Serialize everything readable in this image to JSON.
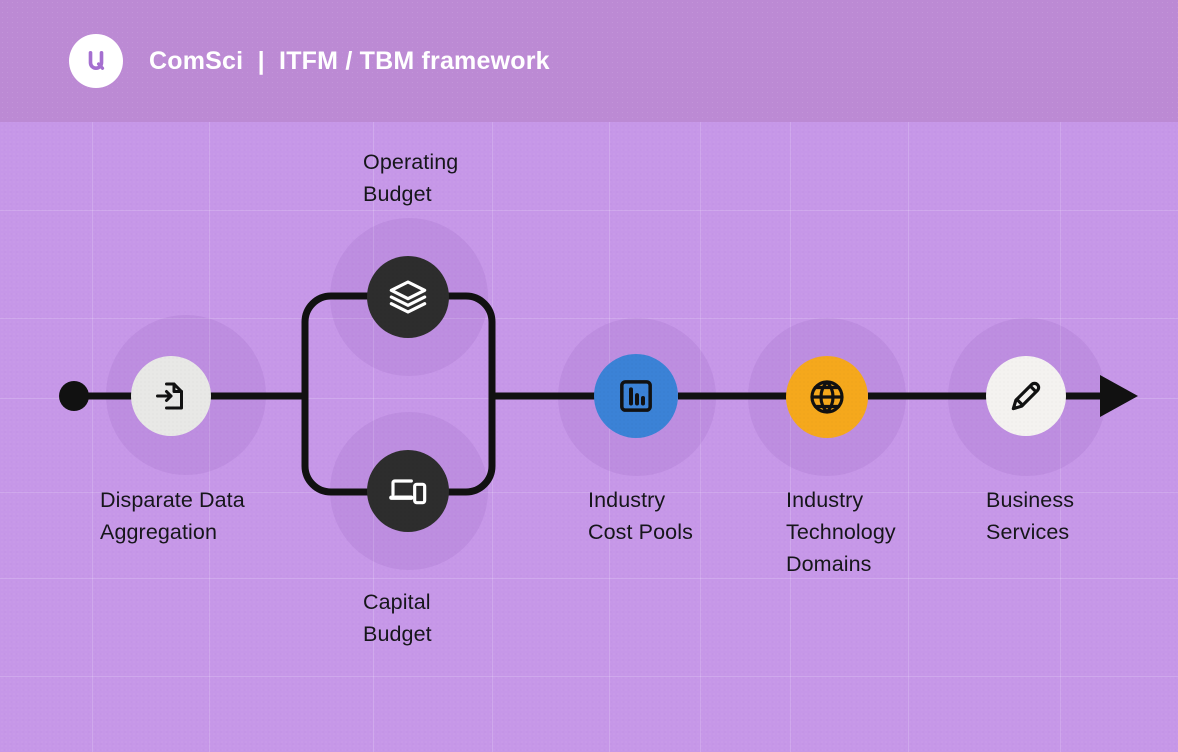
{
  "header": {
    "logo_icon": "comsci-u-logo",
    "title": "ComSci  |  ITFM / TBM framework"
  },
  "colors": {
    "background": "#c697e8",
    "header_band": "#bc8ad4",
    "flow_line": "#111111",
    "node_light": "#e8e8e6",
    "node_dark": "#2d2d2d",
    "node_blue": "#3b82d6",
    "node_orange": "#f5a81c",
    "node_white": "#f4f2f0",
    "label_text": "#16161a",
    "halo": "rgba(120,60,160,0.10)"
  },
  "diagram": {
    "type": "process-flow",
    "direction": "left-to-right",
    "start_marker": "filled-dot",
    "end_marker": "arrowhead",
    "nodes": [
      {
        "id": "disparate-data-aggregation",
        "label": "Disparate Data\nAggregation",
        "icon": "file-input-icon",
        "fill": "#e8e8e6",
        "icon_color": "#111111",
        "stage": 1,
        "branch": "main"
      },
      {
        "id": "operating-budget",
        "label": "Operating\nBudget",
        "icon": "layers-stack-icon",
        "fill": "#2d2d2d",
        "icon_color": "#ffffff",
        "stage": 2,
        "branch": "upper"
      },
      {
        "id": "capital-budget",
        "label": "Capital\nBudget",
        "icon": "devices-icon",
        "fill": "#2d2d2d",
        "icon_color": "#ffffff",
        "stage": 2,
        "branch": "lower"
      },
      {
        "id": "industry-cost-pools",
        "label": "Industry\nCost Pools",
        "icon": "bar-chart-icon",
        "fill": "#3b82d6",
        "icon_color": "#111111",
        "stage": 3,
        "branch": "main"
      },
      {
        "id": "industry-technology-domains",
        "label": "Industry\nTechnology\nDomains",
        "icon": "globe-icon",
        "fill": "#f5a81c",
        "icon_color": "#111111",
        "stage": 4,
        "branch": "main"
      },
      {
        "id": "business-services",
        "label": "Business\nServices",
        "icon": "pen-icon",
        "fill": "#f4f2f0",
        "icon_color": "#111111",
        "stage": 5,
        "branch": "main"
      }
    ]
  }
}
